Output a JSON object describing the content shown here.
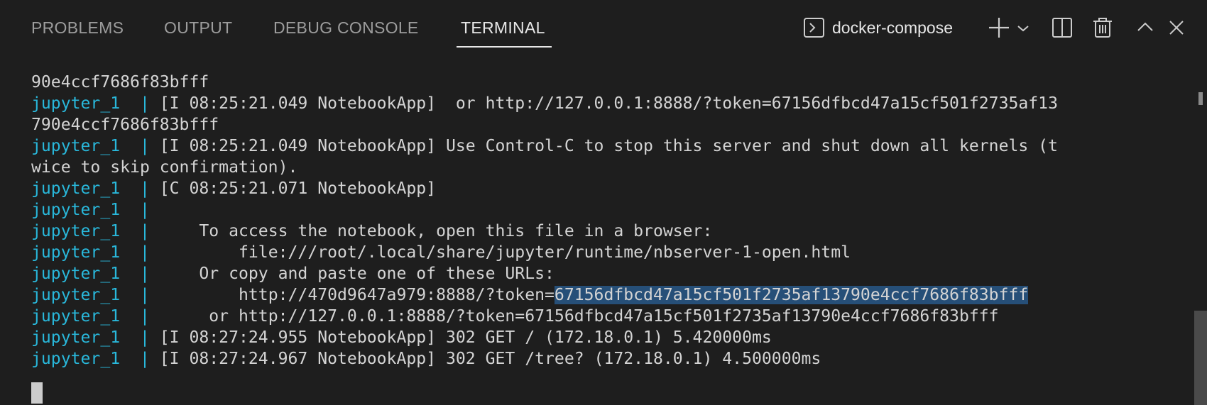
{
  "panel": {
    "tabs": [
      {
        "label": "PROBLEMS"
      },
      {
        "label": "OUTPUT"
      },
      {
        "label": "DEBUG CONSOLE"
      },
      {
        "label": "TERMINAL"
      }
    ],
    "active_tab": "TERMINAL",
    "terminal_name": "docker-compose",
    "icons": [
      "terminal-icon",
      "plus-icon",
      "chevron-down-icon",
      "split-icon",
      "trash-icon",
      "chevron-up-icon",
      "close-icon"
    ]
  },
  "terminal": {
    "lines": [
      {
        "svc": "",
        "bar": "",
        "text": "90e4ccf7686f83bfff"
      },
      {
        "svc": "jupyter_1",
        "bar": "  | ",
        "text": "[I 08:25:21.049 NotebookApp]  or http://127.0.0.1:8888/?token=67156dfbcd47a15cf501f2735af13"
      },
      {
        "svc": "",
        "bar": "",
        "text": "790e4ccf7686f83bfff"
      },
      {
        "svc": "jupyter_1",
        "bar": "  | ",
        "text": "[I 08:25:21.049 NotebookApp] Use Control-C to stop this server and shut down all kernels (t"
      },
      {
        "svc": "",
        "bar": "",
        "text": "wice to skip confirmation)."
      },
      {
        "svc": "jupyter_1",
        "bar": "  | ",
        "text": "[C 08:25:21.071 NotebookApp]"
      },
      {
        "svc": "jupyter_1",
        "bar": "  |",
        "text": ""
      },
      {
        "svc": "jupyter_1",
        "bar": "  | ",
        "text": "    To access the notebook, open this file in a browser:"
      },
      {
        "svc": "jupyter_1",
        "bar": "  | ",
        "text": "        file:///root/.local/share/jupyter/runtime/nbserver-1-open.html"
      },
      {
        "svc": "jupyter_1",
        "bar": "  | ",
        "text": "    Or copy and paste one of these URLs:"
      },
      {
        "svc": "jupyter_1",
        "bar": "  | ",
        "text": "        http://470d9647a979:8888/?token=",
        "highlight": "67156dfbcd47a15cf501f2735af13790e4ccf7686f83bfff"
      },
      {
        "svc": "jupyter_1",
        "bar": "  | ",
        "text": "     or http://127.0.0.1:8888/?token=67156dfbcd47a15cf501f2735af13790e4ccf7686f83bfff"
      },
      {
        "svc": "jupyter_1",
        "bar": "  | ",
        "text": "[I 08:27:24.955 NotebookApp] 302 GET / (172.18.0.1) 5.420000ms"
      },
      {
        "svc": "jupyter_1",
        "bar": "  | ",
        "text": "[I 08:27:24.967 NotebookApp] 302 GET /tree? (172.18.0.1) 4.500000ms"
      }
    ]
  },
  "colors": {
    "background": "#1e1e1e",
    "service_name": "#29b8db",
    "selection": "#264f78"
  }
}
